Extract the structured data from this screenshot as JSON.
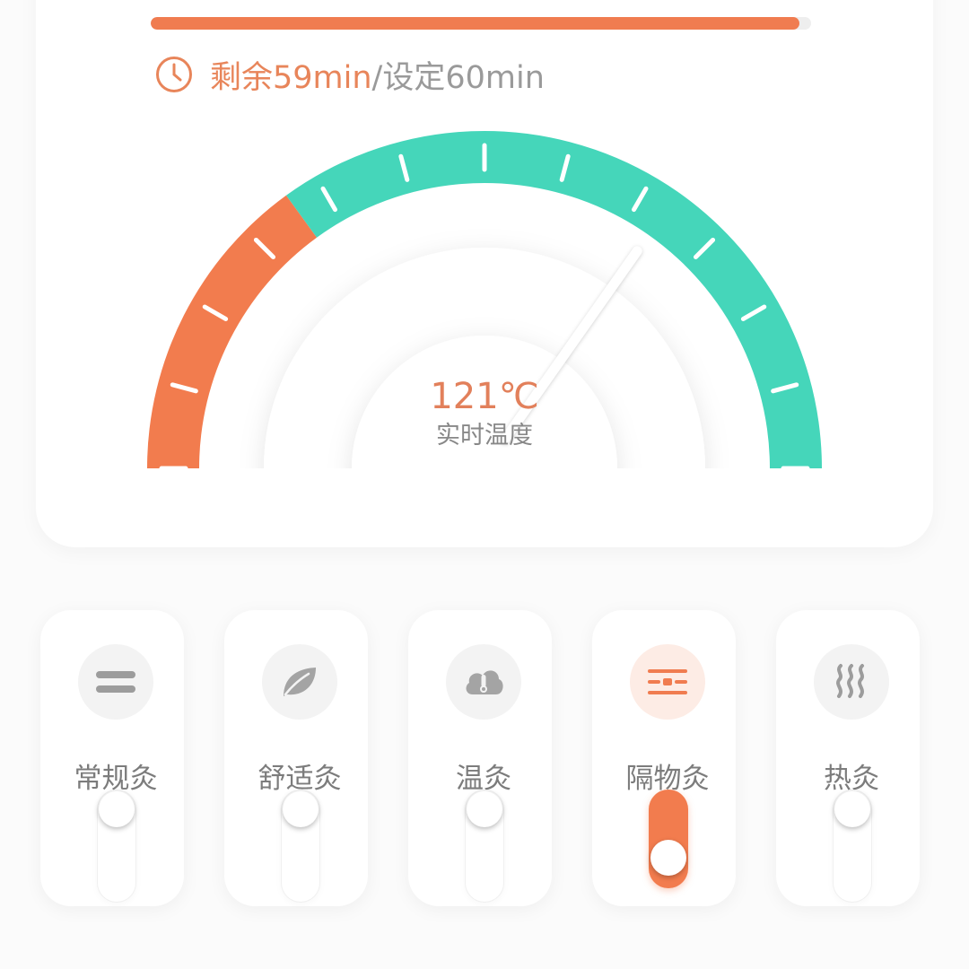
{
  "session": {
    "remaining_text": "剩余59min",
    "setting_text": "/设定60min",
    "progress_fraction": 0.983,
    "clock_icon": "clock-icon"
  },
  "gauge": {
    "temperature_value": "121℃",
    "temperature_label": "实时温度",
    "needle_fraction": 0.695,
    "warning_fraction": 0.3,
    "colors": {
      "warning": "#f27c4e",
      "normal": "#45d6ba",
      "tick": "#ffffff"
    }
  },
  "modes": [
    {
      "label": "常规灸",
      "icon": "equals-icon",
      "on": false
    },
    {
      "label": "舒适灸",
      "icon": "leaf-icon",
      "on": false
    },
    {
      "label": "温灸",
      "icon": "cloud-thermometer-icon",
      "on": false
    },
    {
      "label": "隔物灸",
      "icon": "layered-bars-icon",
      "on": true
    },
    {
      "label": "热灸",
      "icon": "steam-icon",
      "on": false
    }
  ],
  "colors": {
    "accent": "#f07c50",
    "teal": "#45d6ba",
    "muted": "#9a9a9a"
  }
}
